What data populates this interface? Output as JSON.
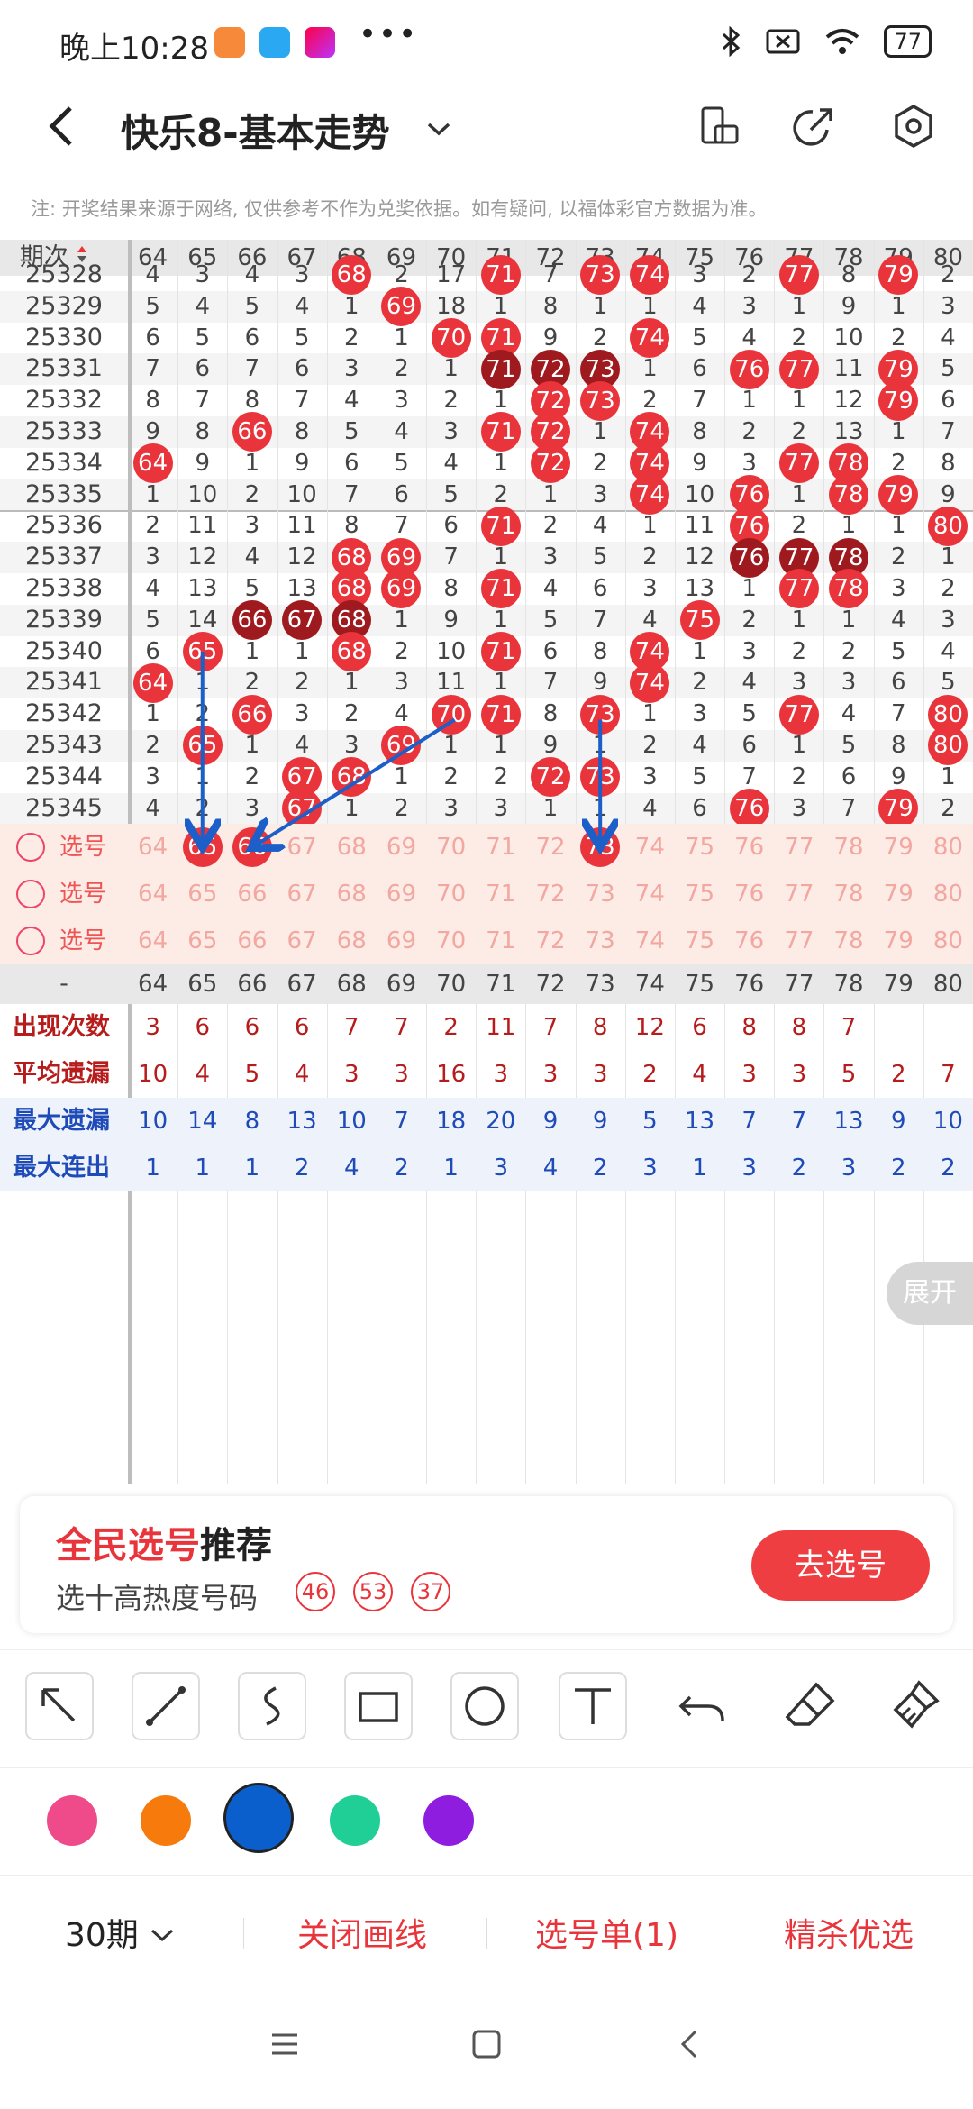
{
  "status": {
    "time": "晚上10:28",
    "more": "•••",
    "battery": "77"
  },
  "app_bar": {
    "title": "快乐8-基本走势",
    "chevron": "⌄"
  },
  "notice": "注: 开奖结果来源于网络, 仅供参考不作为兑奖依据。如有疑问, 以福体彩官方数据为准。",
  "table": {
    "period_label": "期次",
    "columns": [
      "64",
      "65",
      "66",
      "67",
      "68",
      "69",
      "70",
      "71",
      "72",
      "73",
      "74",
      "75",
      "76",
      "77",
      "78",
      "79",
      "80"
    ],
    "rows": [
      {
        "period": "25328",
        "cells": [
          "4",
          "3",
          "4",
          "3",
          "68",
          "2",
          "17",
          "71",
          "7",
          "73",
          "74",
          "3",
          "2",
          "77",
          "8",
          "79",
          "2"
        ],
        "dark": []
      },
      {
        "period": "25329",
        "cells": [
          "5",
          "4",
          "5",
          "4",
          "1",
          "69",
          "18",
          "1",
          "8",
          "1",
          "1",
          "4",
          "3",
          "1",
          "9",
          "1",
          "3"
        ],
        "dark": []
      },
      {
        "period": "25330",
        "cells": [
          "6",
          "5",
          "6",
          "5",
          "2",
          "1",
          "70",
          "71",
          "9",
          "2",
          "74",
          "5",
          "4",
          "2",
          "10",
          "2",
          "4"
        ],
        "dark": []
      },
      {
        "period": "25331",
        "cells": [
          "7",
          "6",
          "7",
          "6",
          "3",
          "2",
          "1",
          "71",
          "72",
          "73",
          "1",
          "6",
          "76",
          "77",
          "11",
          "79",
          "5"
        ],
        "dark": [
          "71",
          "72",
          "73"
        ]
      },
      {
        "period": "25332",
        "cells": [
          "8",
          "7",
          "8",
          "7",
          "4",
          "3",
          "2",
          "1",
          "72",
          "73",
          "2",
          "7",
          "1",
          "1",
          "12",
          "79",
          "6"
        ],
        "dark": []
      },
      {
        "period": "25333",
        "cells": [
          "9",
          "8",
          "66",
          "8",
          "5",
          "4",
          "3",
          "71",
          "72",
          "1",
          "74",
          "8",
          "2",
          "2",
          "13",
          "1",
          "7"
        ],
        "dark": []
      },
      {
        "period": "25334",
        "cells": [
          "64",
          "9",
          "1",
          "9",
          "6",
          "5",
          "4",
          "1",
          "72",
          "2",
          "74",
          "9",
          "3",
          "77",
          "78",
          "2",
          "8"
        ],
        "dark": []
      },
      {
        "period": "25335",
        "cells": [
          "1",
          "10",
          "2",
          "10",
          "7",
          "6",
          "5",
          "2",
          "1",
          "3",
          "74",
          "10",
          "76",
          "1",
          "78",
          "79",
          "9"
        ],
        "dark": []
      },
      {
        "period": "25336",
        "cells": [
          "2",
          "11",
          "3",
          "11",
          "8",
          "7",
          "6",
          "71",
          "2",
          "4",
          "1",
          "11",
          "76",
          "2",
          "1",
          "1",
          "80"
        ],
        "dark": []
      },
      {
        "period": "25337",
        "cells": [
          "3",
          "12",
          "4",
          "12",
          "68",
          "69",
          "7",
          "1",
          "3",
          "5",
          "2",
          "12",
          "76",
          "77",
          "78",
          "2",
          "1"
        ],
        "dark": [
          "76",
          "77",
          "78"
        ]
      },
      {
        "period": "25338",
        "cells": [
          "4",
          "13",
          "5",
          "13",
          "68",
          "69",
          "8",
          "71",
          "4",
          "6",
          "3",
          "13",
          "1",
          "77",
          "78",
          "3",
          "2"
        ],
        "dark": []
      },
      {
        "period": "25339",
        "cells": [
          "5",
          "14",
          "66",
          "67",
          "68",
          "1",
          "9",
          "1",
          "5",
          "7",
          "4",
          "75",
          "2",
          "1",
          "1",
          "4",
          "3"
        ],
        "dark": [
          "66",
          "67",
          "68"
        ]
      },
      {
        "period": "25340",
        "cells": [
          "6",
          "65",
          "1",
          "1",
          "68",
          "2",
          "10",
          "71",
          "6",
          "8",
          "74",
          "1",
          "3",
          "2",
          "2",
          "5",
          "4"
        ],
        "dark": []
      },
      {
        "period": "25341",
        "cells": [
          "64",
          "1",
          "2",
          "2",
          "1",
          "3",
          "11",
          "1",
          "7",
          "9",
          "74",
          "2",
          "4",
          "3",
          "3",
          "6",
          "5"
        ],
        "dark": []
      },
      {
        "period": "25342",
        "cells": [
          "1",
          "2",
          "66",
          "3",
          "2",
          "4",
          "70",
          "71",
          "8",
          "73",
          "1",
          "3",
          "5",
          "77",
          "4",
          "7",
          "80"
        ],
        "dark": []
      },
      {
        "period": "25343",
        "cells": [
          "2",
          "65",
          "1",
          "4",
          "3",
          "69",
          "1",
          "1",
          "9",
          "1",
          "2",
          "4",
          "6",
          "1",
          "5",
          "8",
          "80"
        ],
        "dark": []
      },
      {
        "period": "25344",
        "cells": [
          "3",
          "1",
          "2",
          "67",
          "68",
          "1",
          "2",
          "2",
          "72",
          "73",
          "3",
          "5",
          "7",
          "2",
          "6",
          "9",
          "1"
        ],
        "dark": []
      },
      {
        "period": "25345",
        "cells": [
          "4",
          "2",
          "3",
          "67",
          "1",
          "2",
          "3",
          "3",
          "1",
          "1",
          "4",
          "6",
          "76",
          "3",
          "7",
          "79",
          "2"
        ],
        "dark": []
      }
    ],
    "pick_rows": [
      {
        "label": "选号",
        "selected": [
          "65",
          "66",
          "73"
        ]
      },
      {
        "label": "选号",
        "selected": []
      },
      {
        "label": "选号",
        "selected": []
      }
    ],
    "footer_dash": "-",
    "stats": [
      {
        "label": "出现次数",
        "color": "#b71c1c",
        "values": [
          "3",
          "6",
          "6",
          "6",
          "7",
          "7",
          "2",
          "11",
          "7",
          "8",
          "12",
          "6",
          "8",
          "8",
          "7",
          "",
          ""
        ]
      },
      {
        "label": "平均遗漏",
        "color": "#b71c1c",
        "values": [
          "10",
          "4",
          "5",
          "4",
          "3",
          "3",
          "16",
          "3",
          "3",
          "3",
          "2",
          "4",
          "3",
          "3",
          "5",
          "2",
          "7"
        ]
      },
      {
        "label": "最大遗漏",
        "color": "#1e4bb8",
        "values": [
          "10",
          "14",
          "8",
          "13",
          "10",
          "7",
          "18",
          "20",
          "9",
          "9",
          "5",
          "13",
          "7",
          "7",
          "13",
          "9",
          "10"
        ]
      },
      {
        "label": "最大连出",
        "color": "#1e4bb8",
        "values": [
          "1",
          "1",
          "1",
          "2",
          "4",
          "2",
          "1",
          "3",
          "4",
          "2",
          "3",
          "1",
          "3",
          "2",
          "3",
          "2",
          "2"
        ]
      }
    ],
    "expand_label": "展开"
  },
  "recommend": {
    "title_red": "全民选号",
    "title_black": "推荐",
    "subtitle": "选十高热度号码",
    "balls": [
      "46",
      "53",
      "37"
    ],
    "button": "去选号"
  },
  "tools": [
    "arrow-tool",
    "line-tool",
    "curve-tool",
    "rect-tool",
    "circle-tool",
    "text-tool",
    "undo-tool",
    "eraser-tool",
    "clear-tool"
  ],
  "palette": [
    "#ef4b8b",
    "#f77b0c",
    "#0b5fcc",
    "#1fcf95",
    "#8e1de0"
  ],
  "bottom": {
    "periods": "30期",
    "close_draw": "关闭画线",
    "pick_list": "选号单(1)",
    "kill": "精杀优选"
  },
  "accent": "#e8343a"
}
